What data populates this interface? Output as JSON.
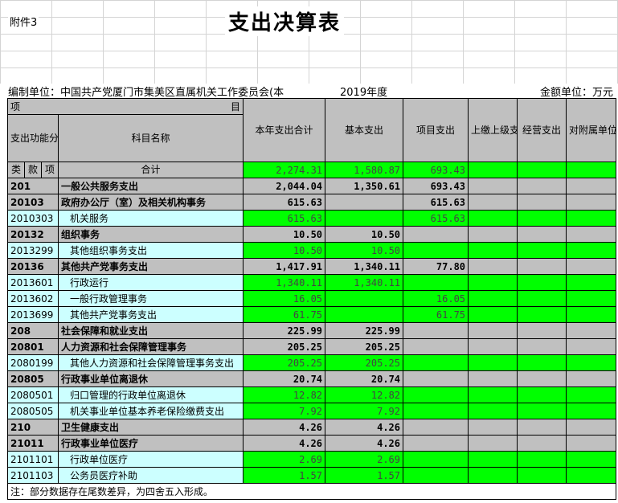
{
  "header": {
    "attachment": "附件3",
    "title": "支出决算表",
    "org": "编制单位：中国共产党厦门市集美区直属机关工作委员会(本",
    "year": "2019年度",
    "unit": "金额单位：万元"
  },
  "table": {
    "top_left": "项",
    "top_right": "目",
    "col_code": "支出功能分类科目编码",
    "col_name": "科目名称",
    "col_total": "本年支出合计",
    "col_basic": "基本支出",
    "col_project": "项目支出",
    "col_upper": "上缴上级支出",
    "col_business": "经营支出",
    "col_subsidiary": "对附属单位补助支出",
    "sub_lei": "类",
    "sub_kuan": "款",
    "sub_xiang": "项",
    "total_label": "合计",
    "total": {
      "total": "2,274.31",
      "basic": "1,580.87",
      "project": "693.43"
    },
    "rows": [
      {
        "code": "201",
        "name": "一般公共服务支出",
        "total": "2,044.04",
        "basic": "1,350.61",
        "project": "693.43",
        "level": 1
      },
      {
        "code": "20103",
        "name": "政府办公厅（室）及相关机构事务",
        "total": "615.63",
        "basic": "",
        "project": "615.63",
        "level": 1
      },
      {
        "code": "2010303",
        "name": "机关服务",
        "total": "615.63",
        "basic": "",
        "project": "615.63",
        "level": 2
      },
      {
        "code": "20132",
        "name": "组织事务",
        "total": "10.50",
        "basic": "10.50",
        "project": "",
        "level": 1
      },
      {
        "code": "2013299",
        "name": "其他组织事务支出",
        "total": "10.50",
        "basic": "10.50",
        "project": "",
        "level": 2
      },
      {
        "code": "20136",
        "name": "其他共产党事务支出",
        "total": "1,417.91",
        "basic": "1,340.11",
        "project": "77.80",
        "level": 1
      },
      {
        "code": "2013601",
        "name": "行政运行",
        "total": "1,340.11",
        "basic": "1,340.11",
        "project": "",
        "level": 2
      },
      {
        "code": "2013602",
        "name": "一般行政管理事务",
        "total": "16.05",
        "basic": "",
        "project": "16.05",
        "level": 2
      },
      {
        "code": "2013699",
        "name": "其他共产党事务支出",
        "total": "61.75",
        "basic": "",
        "project": "61.75",
        "level": 2
      },
      {
        "code": "208",
        "name": "社会保障和就业支出",
        "total": "225.99",
        "basic": "225.99",
        "project": "",
        "level": 1
      },
      {
        "code": "20801",
        "name": "人力资源和社会保障管理事务",
        "total": "205.25",
        "basic": "205.25",
        "project": "",
        "level": 1
      },
      {
        "code": "2080199",
        "name": "其他人力资源和社会保障管理事务支出",
        "total": "205.25",
        "basic": "205.25",
        "project": "",
        "level": 2
      },
      {
        "code": "20805",
        "name": "行政事业单位离退休",
        "total": "20.74",
        "basic": "20.74",
        "project": "",
        "level": 1
      },
      {
        "code": "2080501",
        "name": "归口管理的行政单位离退休",
        "total": "12.82",
        "basic": "12.82",
        "project": "",
        "level": 2
      },
      {
        "code": "2080505",
        "name": "机关事业单位基本养老保险缴费支出",
        "total": "7.92",
        "basic": "7.92",
        "project": "",
        "level": 2
      },
      {
        "code": "210",
        "name": "卫生健康支出",
        "total": "4.26",
        "basic": "4.26",
        "project": "",
        "level": 1
      },
      {
        "code": "21011",
        "name": "行政事业单位医疗",
        "total": "4.26",
        "basic": "4.26",
        "project": "",
        "level": 1
      },
      {
        "code": "2101101",
        "name": "行政单位医疗",
        "total": "2.69",
        "basic": "2.69",
        "project": "",
        "level": 2
      },
      {
        "code": "2101103",
        "name": "公务员医疗补助",
        "total": "1.57",
        "basic": "1.57",
        "project": "",
        "level": 2
      }
    ],
    "note": "注：部分数据存在尾数差异，为四舍五入形成。"
  },
  "colors": {
    "header_gray": "#c0c0c0",
    "value_green": "#00ff00",
    "code_cyan": "#ccffff"
  }
}
